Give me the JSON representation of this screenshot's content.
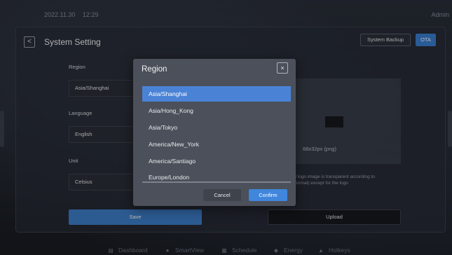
{
  "status_bar": {
    "date": "2022.11.30",
    "time": "12:29",
    "user": "Admin"
  },
  "panel": {
    "back_icon": "chevron-left-icon",
    "back_glyph": "<",
    "title": "System Setting",
    "backup_label": "System Backup",
    "ota_label": "OTA"
  },
  "form": {
    "region_label": "Region",
    "region_value": "Asia/Shanghai",
    "language_label": "Language",
    "language_value": "English",
    "unit_label": "Unit",
    "unit_value": "Celsius",
    "save_label": "Save"
  },
  "logo": {
    "size_text": "68x32px  (png)",
    "note_line1": "ded logo image is transparent according to",
    "note_line2": "ng format) except for the logo",
    "upload_label": "Upload"
  },
  "region_dialog": {
    "title": "Region",
    "close_glyph": "×",
    "options": [
      "Asia/Shanghai",
      "Asia/Hong_Kong",
      "Asia/Tokyo",
      "America/New_York",
      "America/Santiago",
      "Europe/London"
    ],
    "selected_index": 0,
    "cancel_label": "Cancel",
    "confirm_label": "Confirm"
  },
  "bottom_nav": [
    {
      "label": "Dashboard",
      "icon": "dashboard-icon",
      "glyph": "▤"
    },
    {
      "label": "SmartView",
      "icon": "smartview-icon",
      "glyph": "●"
    },
    {
      "label": "Schedule",
      "icon": "schedule-icon",
      "glyph": "▦"
    },
    {
      "label": "Energy",
      "icon": "energy-icon",
      "glyph": "◆"
    },
    {
      "label": "Hotkeys",
      "icon": "hotkeys-icon",
      "glyph": "▲"
    }
  ],
  "colors": {
    "accent": "#3f86dc",
    "background": "#1c2029",
    "modal": "#4b505a"
  }
}
